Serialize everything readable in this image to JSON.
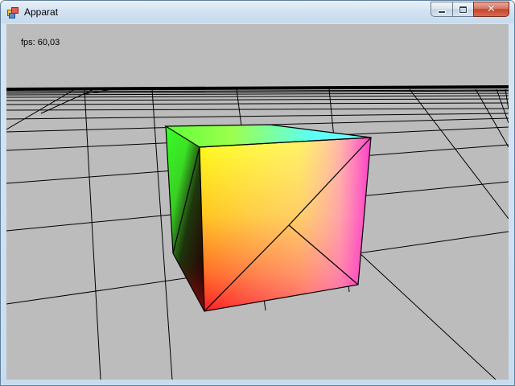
{
  "window": {
    "title": "Apparat",
    "app_icon": "app-window-icon",
    "buttons": {
      "minimize": "minimize-icon",
      "maximize": "maximize-icon",
      "close": "close-icon"
    }
  },
  "viewport": {
    "background_color": "#bcbcbc",
    "fps_label": "fps:",
    "fps_value": "60,03"
  },
  "scene": {
    "floor": "grid plane",
    "object": "rgb color cube"
  }
}
